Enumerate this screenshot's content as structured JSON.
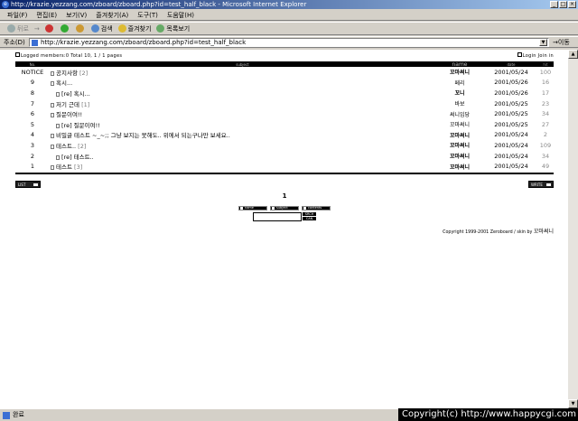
{
  "window": {
    "title": "http://krazie.yezzang.com/zboard/zboard.php?id=test_half_black - Microsoft Internet Explorer",
    "min_label": "_",
    "max_label": "□",
    "close_label": "×"
  },
  "menu": [
    "파일(F)",
    "편집(E)",
    "보기(V)",
    "즐겨찾기(A)",
    "도구(T)",
    "도움말(H)"
  ],
  "toolbar": {
    "back": "뒤로",
    "forward": "→",
    "search": "검색",
    "favorites": "즐겨찾기",
    "history": "목록보기"
  },
  "address": {
    "label": "주소(D)",
    "url": "http://krazie.yezzang.com/zboard/zboard.php?id=test_half_black",
    "go": "이동"
  },
  "board": {
    "members_info": "Logged members:0 Total 10, 1 / 1 pages",
    "login_link": "Login Join in",
    "headers": {
      "no": "No.",
      "subject": "subject",
      "name": "name",
      "date": "date",
      "hit": "hit"
    },
    "rows": [
      {
        "no": "NOTICE",
        "depth": 0,
        "subject": "공지사항",
        "comments": "[2]",
        "name": "꼬마써니",
        "bold": true,
        "date": "2001/05/24",
        "hit": "100"
      },
      {
        "no": "9",
        "depth": 0,
        "subject": "혹시...",
        "comments": "",
        "name": "페리",
        "bold": false,
        "date": "2001/05/26",
        "hit": "16"
      },
      {
        "no": "8",
        "depth": 1,
        "subject": "[re] 혹시...",
        "comments": "",
        "name": "꼬니",
        "bold": true,
        "date": "2001/05/26",
        "hit": "17"
      },
      {
        "no": "7",
        "depth": 0,
        "subject": "저기 근데",
        "comments": "[1]",
        "name": "바보",
        "bold": false,
        "date": "2001/05/25",
        "hit": "23"
      },
      {
        "no": "6",
        "depth": 0,
        "subject": "질문이여!!",
        "comments": "",
        "name": "써니임당",
        "bold": false,
        "date": "2001/05/25",
        "hit": "34"
      },
      {
        "no": "5",
        "depth": 1,
        "subject": "[re] 질문이여!!",
        "comments": "",
        "name": "꼬마써니",
        "bold": false,
        "date": "2001/05/25",
        "hit": "27"
      },
      {
        "no": "4",
        "depth": 0,
        "subject": "비밀글 테스트 ~_~;; 그냥 보지는 못해도.. 위에서 되는구나만 보세요..",
        "comments": "",
        "name": "꼬마써니",
        "bold": true,
        "date": "2001/05/24",
        "hit": "2"
      },
      {
        "no": "3",
        "depth": 0,
        "subject": "테스트..",
        "comments": "[2]",
        "name": "꼬마써니",
        "bold": true,
        "date": "2001/05/24",
        "hit": "109"
      },
      {
        "no": "2",
        "depth": 1,
        "subject": "[re] 테스트..",
        "comments": "",
        "name": "꼬마써니",
        "bold": true,
        "date": "2001/05/24",
        "hit": "34"
      },
      {
        "no": "1",
        "depth": 0,
        "subject": "테스트",
        "comments": "[3]",
        "name": "꼬마써니",
        "bold": true,
        "date": "2001/05/24",
        "hit": "49"
      }
    ],
    "list_button": "LIST",
    "write_button": "WRITE",
    "page_number": "1",
    "search_options": [
      "name",
      "subject",
      "contents"
    ],
    "search_button": "SRCH",
    "cancel_button": "CAN",
    "copyright_text": "Copyright 1999-2001 Zeroboard / skin by",
    "skin_author": "꼬마써니"
  },
  "status_text": "완료",
  "watermark": "Copyright(c) http://www.happycgi.com"
}
